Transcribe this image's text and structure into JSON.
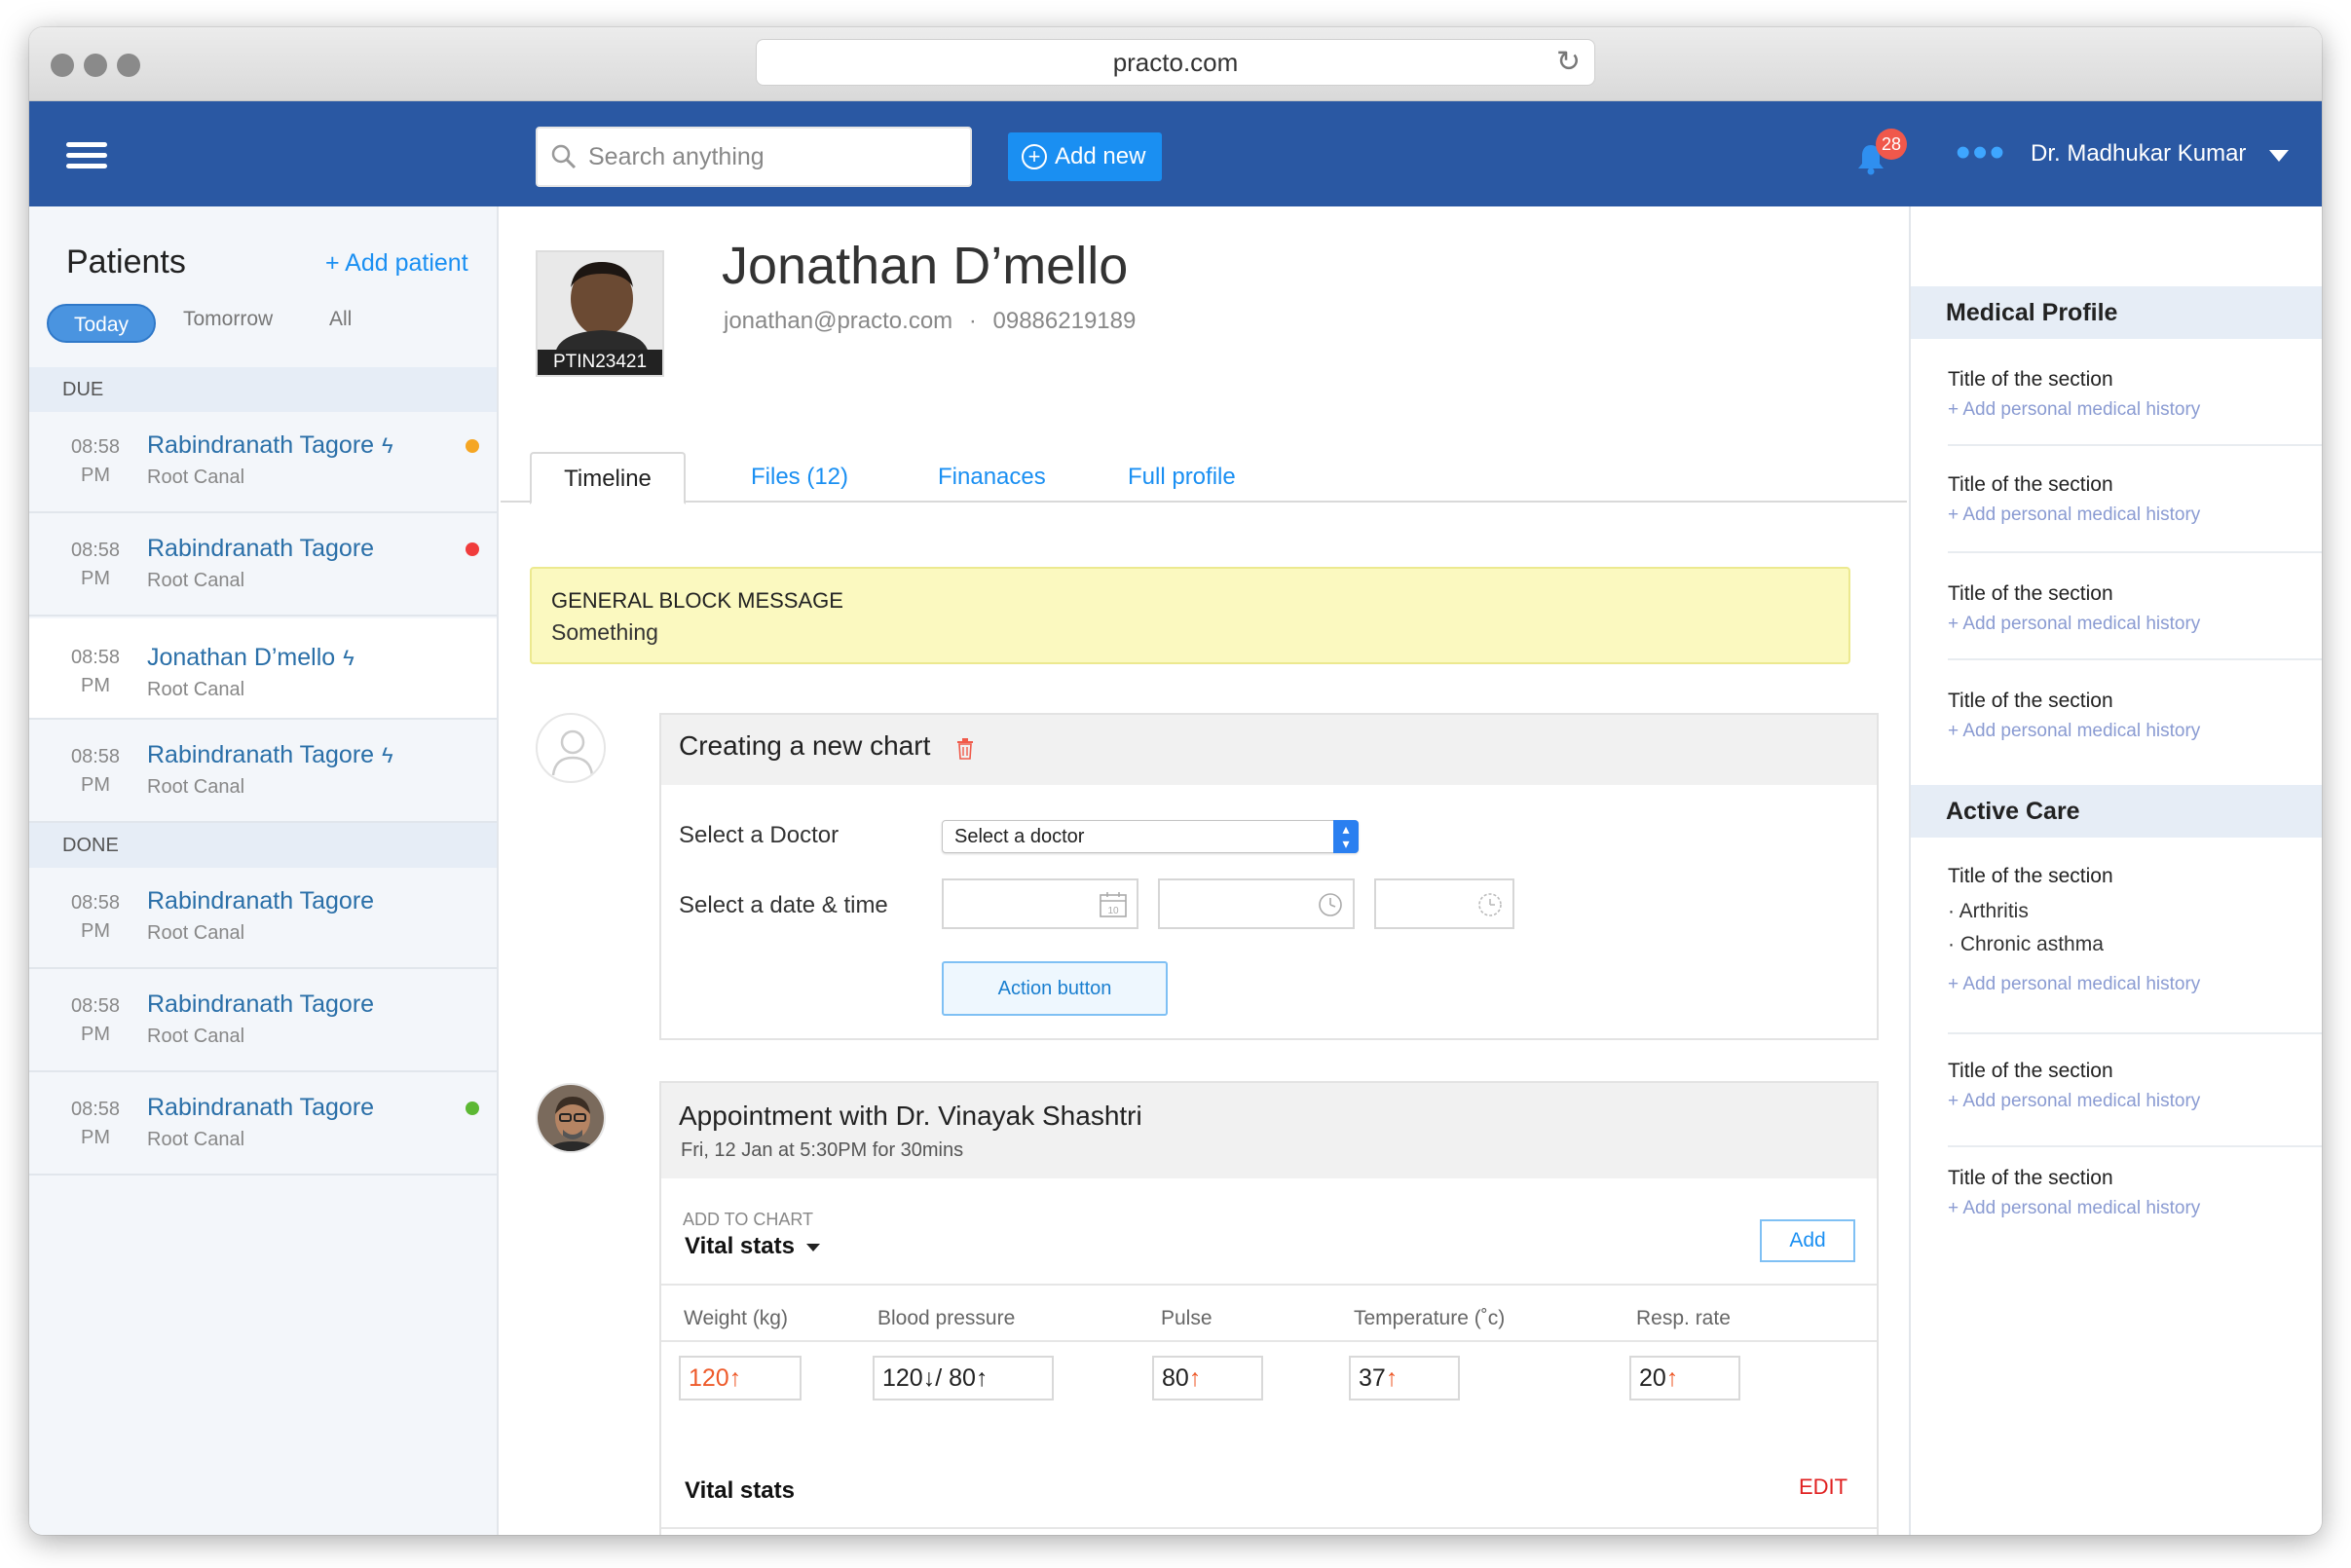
{
  "browser": {
    "url": "practo.com"
  },
  "header": {
    "search_placeholder": "Search anything",
    "add_new": "Add new",
    "notification_count": "28",
    "user_name": "Dr. Madhukar Kumar"
  },
  "sidebar": {
    "title": "Patients",
    "add_patient": "+ Add patient",
    "filters": [
      "Today",
      "Tomorrow",
      "All"
    ],
    "due_label": "DUE",
    "done_label": "DONE",
    "due": [
      {
        "time": "08:58",
        "ampm": "PM",
        "name": "Rabindranath Tagore",
        "bolt": "ϟ",
        "procedure": "Root Canal",
        "status": "#f5a623"
      },
      {
        "time": "08:58",
        "ampm": "PM",
        "name": "Rabindranath Tagore",
        "bolt": "",
        "procedure": "Root Canal",
        "status": "#f03c3c"
      },
      {
        "time": "08:58",
        "ampm": "PM",
        "name": "Jonathan D’mello",
        "bolt": "ϟ",
        "procedure": "Root Canal",
        "status": ""
      },
      {
        "time": "08:58",
        "ampm": "PM",
        "name": "Rabindranath Tagore",
        "bolt": "ϟ",
        "procedure": "Root Canal",
        "status": ""
      }
    ],
    "done": [
      {
        "time": "08:58",
        "ampm": "PM",
        "name": "Rabindranath Tagore",
        "procedure": "Root Canal",
        "status": ""
      },
      {
        "time": "08:58",
        "ampm": "PM",
        "name": "Rabindranath Tagore",
        "procedure": "Root Canal",
        "status": ""
      },
      {
        "time": "08:58",
        "ampm": "PM",
        "name": "Rabindranath Tagore",
        "procedure": "Root Canal",
        "status": "#5cb833"
      }
    ]
  },
  "patient": {
    "name": "Jonathan D’mello",
    "email": "jonathan@practo.com",
    "phone": "09886219189",
    "separator": "·",
    "id": "PTIN23421"
  },
  "tabs": [
    "Timeline",
    "Files (12)",
    "Finanaces",
    "Full profile"
  ],
  "message": {
    "title": "GENERAL BLOCK MESSAGE",
    "body": "Something"
  },
  "chart_card": {
    "title": "Creating a new chart",
    "doctor_label": "Select a Doctor",
    "doctor_select": "Select a doctor",
    "datetime_label": "Select a date & time",
    "calendar_day": "10",
    "action": "Action button"
  },
  "appointment": {
    "title": "Appointment with Dr. Vinayak Shashtri",
    "subtitle": "Fri, 12 Jan at 5:30PM for 30mins",
    "add_to_chart": "ADD TO CHART",
    "vital_stats": "Vital stats",
    "add": "Add",
    "columns": [
      "Weight (kg)",
      "Blood pressure",
      "Pulse",
      "Temperature (˚c)",
      "Resp. rate"
    ],
    "values": {
      "weight": "120",
      "bp_sys": "120",
      "bp_dia": "80",
      "pulse": "80",
      "temp": "37",
      "resp": "20"
    },
    "vital_stats_2": "Vital stats",
    "edit": "EDIT"
  },
  "right_panel": {
    "medical_profile": "Medical Profile",
    "active_care": "Active Care",
    "section_title": "Title of the section",
    "add_history": "+ Add personal medical history",
    "conditions": [
      "· Arthritis",
      "· Chronic asthma"
    ]
  },
  "colors": {
    "header": "#2a58a3",
    "accent": "#1a8ff2",
    "link": "#2a6fa8"
  }
}
